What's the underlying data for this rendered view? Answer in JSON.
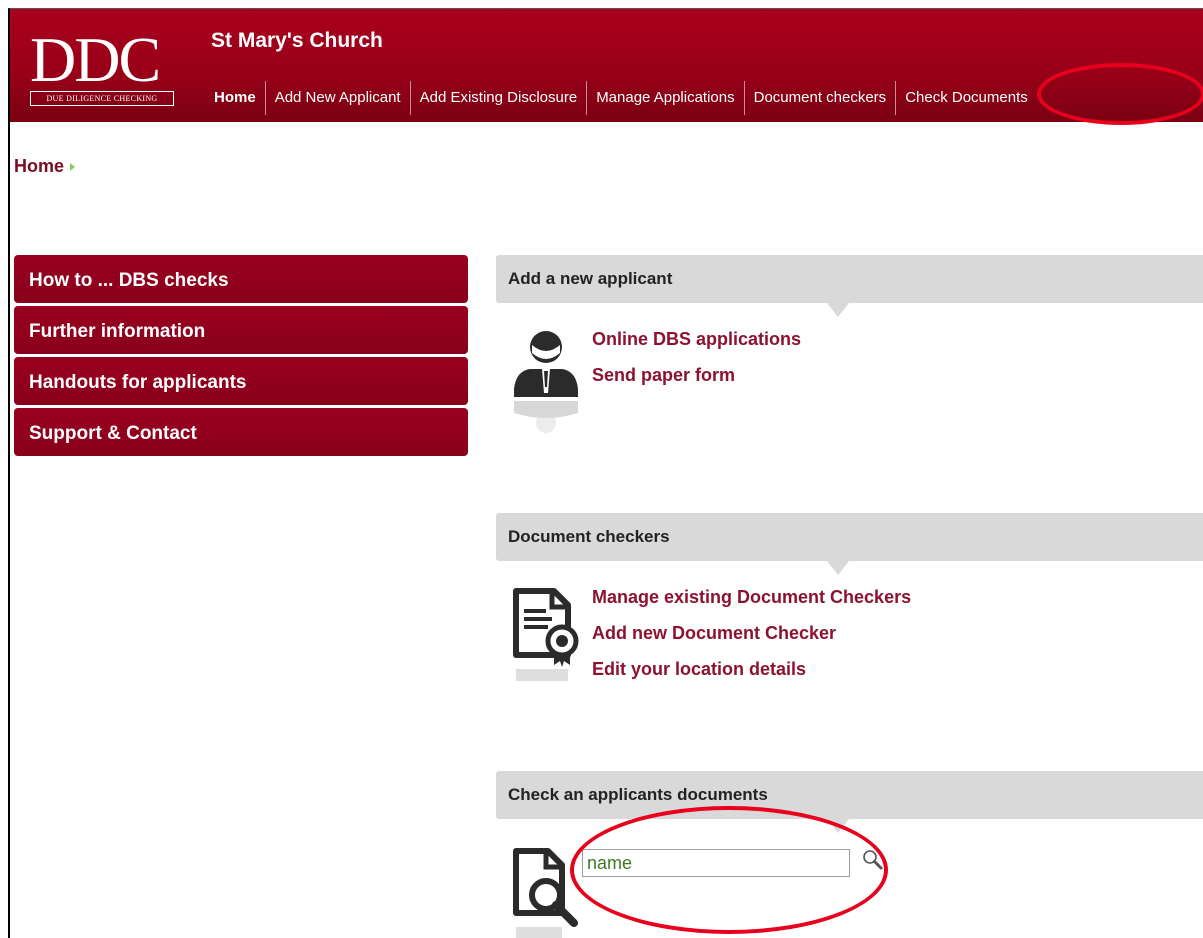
{
  "header": {
    "logo_letters": "DDC",
    "logo_tagline": "Due Diligence Checking",
    "org_name": "St Mary's Church",
    "nav": [
      "Home",
      "Add New Applicant",
      "Add Existing Disclosure",
      "Manage Applications",
      "Document checkers",
      "Check Documents"
    ]
  },
  "breadcrumb": {
    "label": "Home"
  },
  "sidebar": {
    "items": [
      "How to ... DBS checks",
      "Further information",
      "Handouts for applicants",
      "Support & Contact"
    ]
  },
  "panels": {
    "new_applicant": {
      "title": "Add a new applicant",
      "icon": "person-icon",
      "links": [
        "Online DBS applications",
        "Send paper form"
      ]
    },
    "document_checkers": {
      "title": "Document checkers",
      "icon": "document-certificate-icon",
      "links": [
        "Manage existing Document Checkers",
        "Add new Document Checker",
        "Edit your location details"
      ]
    },
    "check_documents": {
      "title": "Check an applicants documents",
      "icon": "document-search-icon",
      "search": {
        "value": "name",
        "icon": "search-icon"
      }
    }
  },
  "colors": {
    "header": "#9a0018",
    "sidebar": "#8f001c",
    "link": "#8c1230",
    "panel_header": "#d9d9d9",
    "annotation": "#e8001c"
  }
}
